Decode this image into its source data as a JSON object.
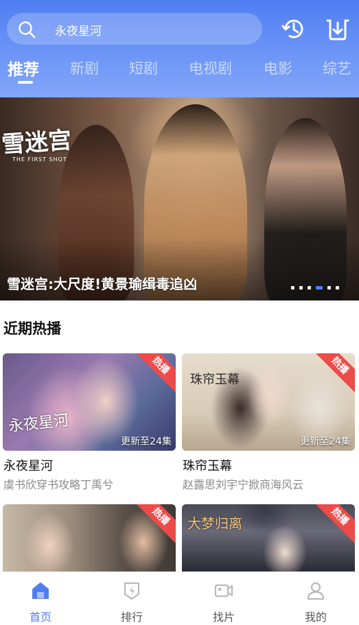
{
  "colors": {
    "accent": "#4f7ef2",
    "hot_ribbon": "#ef4a4a",
    "muted_text": "#8a8a8a"
  },
  "header": {
    "search": {
      "placeholder": "永夜星河",
      "icon": "search-icon"
    },
    "actions": [
      {
        "name": "history",
        "icon": "history-icon"
      },
      {
        "name": "download",
        "icon": "download-icon"
      }
    ],
    "tabs": [
      {
        "label": "推荐",
        "active": true
      },
      {
        "label": "新剧",
        "active": false
      },
      {
        "label": "短剧",
        "active": false
      },
      {
        "label": "电视剧",
        "active": false
      },
      {
        "label": "电影",
        "active": false
      },
      {
        "label": "综艺",
        "active": false
      }
    ]
  },
  "banner": {
    "title": "雪迷宫:大尺度!黄景瑜缉毒追凶",
    "logo_text": "雪迷宫",
    "logo_subtext": "THE FIRST SHOT",
    "slide_count": 6,
    "active_slide": 4
  },
  "section": {
    "title": "近期热播",
    "cards": [
      {
        "title": "永夜星河",
        "desc": "虞书欣穿书攻略丁禹兮",
        "badge": "热播",
        "update": "更新至24集",
        "poster_text": "永夜星河"
      },
      {
        "title": "珠帘玉幕",
        "desc": "赵露思刘宇宁掀商海风云",
        "badge": "热播",
        "update": "更新至24集",
        "poster_text": "珠帘玉幕"
      },
      {
        "title": "",
        "desc": "",
        "badge": "热播",
        "update": "",
        "poster_text": ""
      },
      {
        "title": "",
        "desc": "",
        "badge": "热播",
        "update": "",
        "poster_text": "大梦归离"
      }
    ]
  },
  "bottom_nav": [
    {
      "label": "首页",
      "icon": "home-icon",
      "active": true
    },
    {
      "label": "排行",
      "icon": "ranking-icon",
      "active": false
    },
    {
      "label": "找片",
      "icon": "video-camera-icon",
      "active": false
    },
    {
      "label": "我的",
      "icon": "user-icon",
      "active": false
    }
  ]
}
